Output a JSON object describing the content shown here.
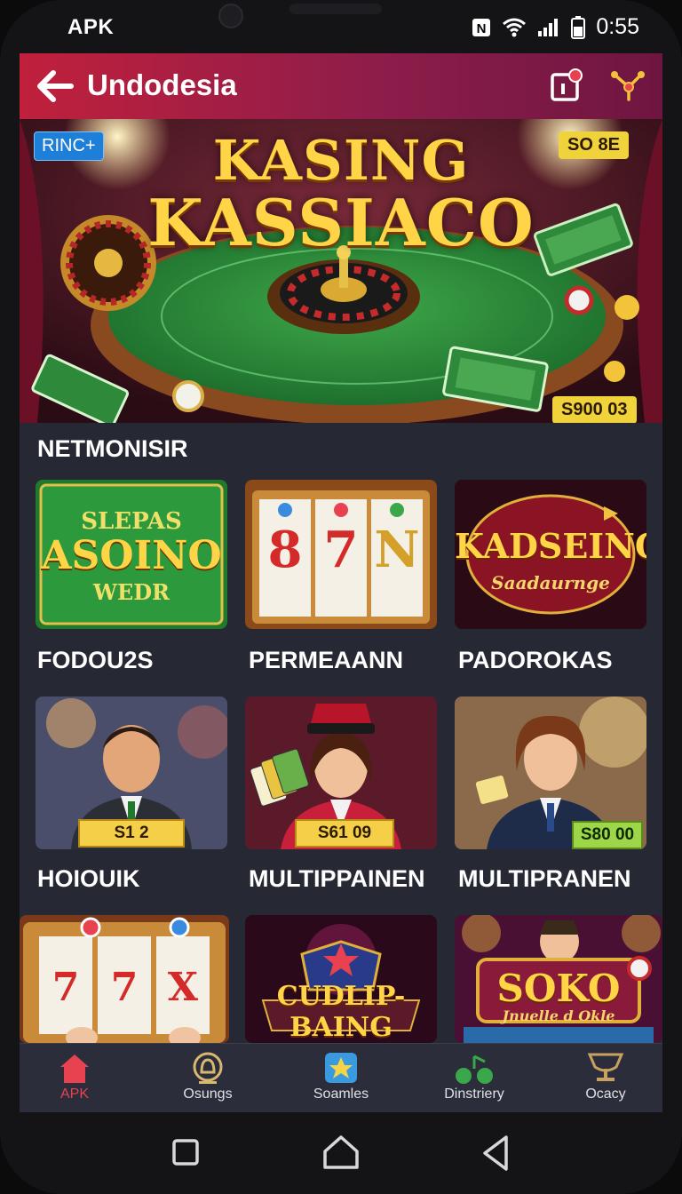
{
  "status_bar": {
    "carrier": "APK",
    "time": "0:55"
  },
  "app_bar": {
    "title": "Undodesia"
  },
  "banner": {
    "title_line1": "KASING",
    "title_line2": "KASSIACO",
    "badge_left": "RINC+",
    "badge_right": "SO 8E",
    "badge_bottom": "S900 03"
  },
  "section": {
    "heading": "NETMONISIR"
  },
  "tiles": [
    {
      "label": "FODOU2S",
      "line1": "SLEPAS",
      "line2": "ASOINO",
      "line3": "WEDR"
    },
    {
      "label": "PERMEAANN",
      "reels": [
        "8",
        "7",
        "N"
      ]
    },
    {
      "label": "PADOROKAS",
      "line1": "KADSEINO",
      "line2": "Saadaurnge"
    },
    {
      "label": "HOIOUIK",
      "price": "S1 2"
    },
    {
      "label": "MULTIPPAINEN",
      "price": "S61 09"
    },
    {
      "label": "MULTIPRANEN",
      "price": "S80 00"
    },
    {
      "reels": [
        "7",
        "7",
        "X"
      ]
    },
    {
      "line1": "CUDLIP-BAING"
    },
    {
      "line1": "SOKO",
      "line2": "Jnuelle d Okle"
    }
  ],
  "bottom_nav": [
    {
      "label": "APK",
      "icon": "home-icon",
      "active": true
    },
    {
      "label": "Osungs",
      "icon": "bell-icon"
    },
    {
      "label": "Soamles",
      "icon": "star-icon"
    },
    {
      "label": "Dinstriery",
      "icon": "chips-icon"
    },
    {
      "label": "Ocacy",
      "icon": "trophy-icon"
    }
  ],
  "colors": {
    "accent": "#c0203c",
    "background": "#262934",
    "gold": "#ffd447",
    "active_nav": "#e8414f"
  }
}
